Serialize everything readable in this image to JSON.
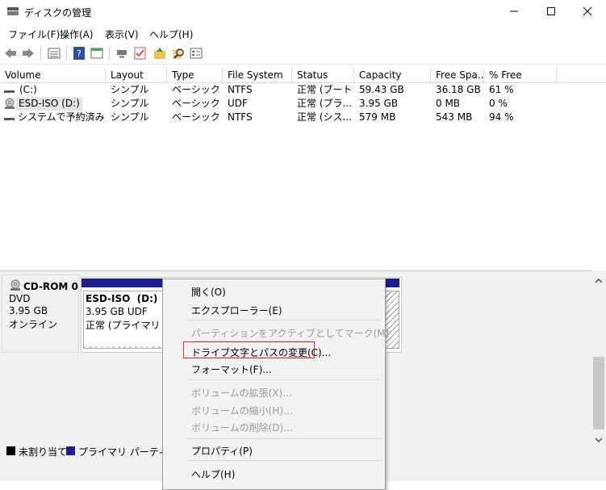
{
  "window": {
    "title": "ディスクの管理",
    "icon": "disk-management-icon",
    "controls": [
      "minimize-icon",
      "maximize-icon",
      "close-icon"
    ]
  },
  "menu": [
    "ファイル(F)",
    "操作(A)",
    "表示(V)",
    "ヘルプ(H)"
  ],
  "toolbar": [
    "back-arrow-icon",
    "forward-arrow-icon",
    "list-view-icon",
    "help-icon",
    "properties-icon",
    "connect-icon",
    "check-icon",
    "up-folder-icon",
    "search-icon",
    "settings-icon"
  ],
  "columns": [
    "Volume",
    "Layout",
    "Type",
    "File System",
    "Status",
    "Capacity",
    "Free Spa...",
    "% Free"
  ],
  "volumes": [
    {
      "name": "(C:)",
      "layout": "シンプル",
      "type": "ベーシック",
      "fs": "NTFS",
      "status": "正常 (ブート...",
      "capacity": "59.43 GB",
      "free": "36.18 GB",
      "pct": "61 %",
      "icon": "drive-icon"
    },
    {
      "name": "ESD-ISO (D:)",
      "layout": "シンプル",
      "type": "ベーシック",
      "fs": "UDF",
      "status": "正常 (プラ...",
      "capacity": "3.95 GB",
      "free": "0 MB",
      "pct": "0 %",
      "icon": "cdrom-icon"
    },
    {
      "name": "システムで予約済み",
      "layout": "シンプル",
      "type": "ベーシック",
      "fs": "NTFS",
      "status": "正常 (シス...",
      "capacity": "579 MB",
      "free": "543 MB",
      "pct": "94 %",
      "icon": "drive-icon"
    }
  ],
  "disk": {
    "name": "CD-ROM 0",
    "type": "DVD",
    "size": "3.95 GB",
    "state": "オンライン",
    "partition": {
      "name": "ESD-ISO  (D:)",
      "size_fs": "3.95 GB UDF",
      "status": "正常 (プライマリ パー"
    }
  },
  "legend": [
    {
      "label": "未割り当て",
      "color": "#000000"
    },
    {
      "label": "プライマリ パーティション",
      "color": "#1e1e8c"
    }
  ],
  "context_menu": [
    {
      "label": "開く(O)",
      "enabled": true
    },
    {
      "label": "エクスプローラー(E)",
      "enabled": true
    },
    {
      "label": "パーティションをアクティブとしてマーク(M)",
      "enabled": false
    },
    {
      "label": "ドライブ文字とパスの変更(C)...",
      "enabled": true,
      "highlighted": true
    },
    {
      "label": "フォーマット(F)...",
      "enabled": true
    },
    {
      "label": "ボリュームの拡張(X)...",
      "enabled": false
    },
    {
      "label": "ボリュームの縮小(H)...",
      "enabled": false
    },
    {
      "label": "ボリュームの削除(D)...",
      "enabled": false
    },
    {
      "label": "プロパティ(P)",
      "enabled": true
    },
    {
      "label": "ヘルプ(H)",
      "enabled": true
    }
  ],
  "colors": {
    "highlight_border": "#e0241c",
    "partition_bar": "#1e1e8c"
  }
}
